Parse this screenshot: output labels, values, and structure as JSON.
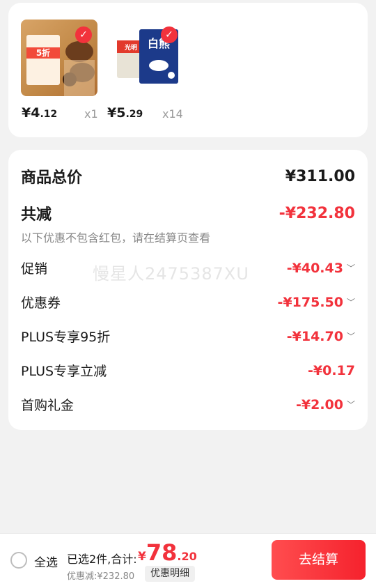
{
  "products": [
    {
      "price_int": "¥4",
      "price_dec": ".12",
      "qty": "x1",
      "badge_text": "5折"
    },
    {
      "price_int": "¥5",
      "price_dec": ".29",
      "qty": "x14",
      "brand_text": "白熊",
      "brand_sub": "光明"
    }
  ],
  "summary": {
    "total_label": "商品总价",
    "total_value": "¥311.00",
    "reduce_label": "共减",
    "reduce_value": "-¥232.80",
    "note": "以下优惠不包含红包，请在结算页查看",
    "watermark": "慢星人2475387XU",
    "items": [
      {
        "label": "促销",
        "value": "-¥40.43",
        "expandable": true
      },
      {
        "label": "优惠券",
        "value": "-¥175.50",
        "expandable": true
      },
      {
        "label": "PLUS专享95折",
        "value": "-¥14.70",
        "expandable": true
      },
      {
        "label": "PLUS专享立减",
        "value": "-¥0.17",
        "expandable": false
      },
      {
        "label": "首购礼金",
        "value": "-¥2.00",
        "expandable": true
      }
    ]
  },
  "bottom": {
    "select_all": "全选",
    "selected_text": "已选2件,合计:",
    "total_symbol": "¥",
    "total_int": "78",
    "total_dec": ".20",
    "discount_text": "优惠减:¥232.80",
    "detail_button": "优惠明细",
    "checkout_button": "去结算"
  },
  "colors": {
    "accent": "#f2323c",
    "background": "#f2f2f2"
  },
  "icons": {
    "check": "checkmark-icon",
    "chevron": "chevron-down-icon"
  }
}
